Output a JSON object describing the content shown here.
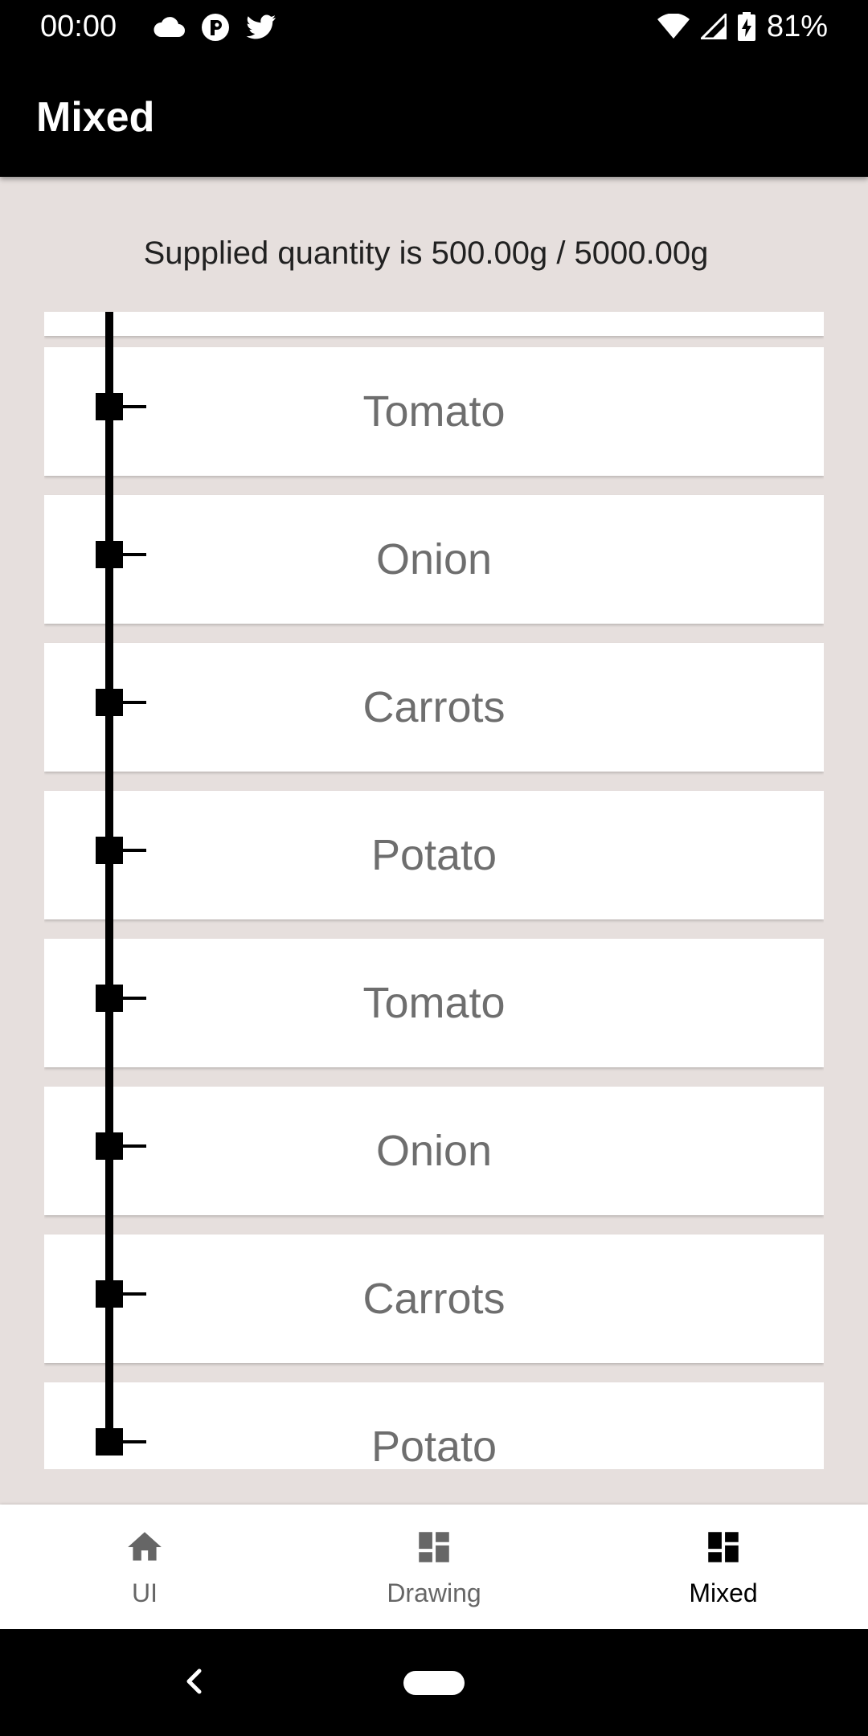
{
  "status_bar": {
    "time": "00:00",
    "left_icons": [
      "cloud-icon",
      "app-notification-icon",
      "twitter-icon"
    ],
    "right_icons": [
      "wifi-icon",
      "cellular-signal-icon",
      "battery-charging-icon"
    ],
    "battery": "81%"
  },
  "app_bar": {
    "title": "Mixed"
  },
  "summary": {
    "text": "Supplied quantity is 500.00g / 5000.00g"
  },
  "list": {
    "items": [
      {
        "label": ""
      },
      {
        "label": "Tomato"
      },
      {
        "label": "Onion"
      },
      {
        "label": "Carrots"
      },
      {
        "label": "Potato"
      },
      {
        "label": "Tomato"
      },
      {
        "label": "Onion"
      },
      {
        "label": "Carrots"
      },
      {
        "label": "Potato"
      }
    ]
  },
  "bottom_nav": {
    "items": [
      {
        "label": "UI",
        "icon": "home-icon",
        "active": false
      },
      {
        "label": "Drawing",
        "icon": "dashboard-icon",
        "active": false
      },
      {
        "label": "Mixed",
        "icon": "dashboard-icon",
        "active": true
      }
    ]
  },
  "colors": {
    "background": "#e6dfdd",
    "bar": "#000000",
    "card": "#ffffff",
    "card_text": "#6e6e6e",
    "nav_inactive": "#666666",
    "nav_active": "#000000"
  }
}
